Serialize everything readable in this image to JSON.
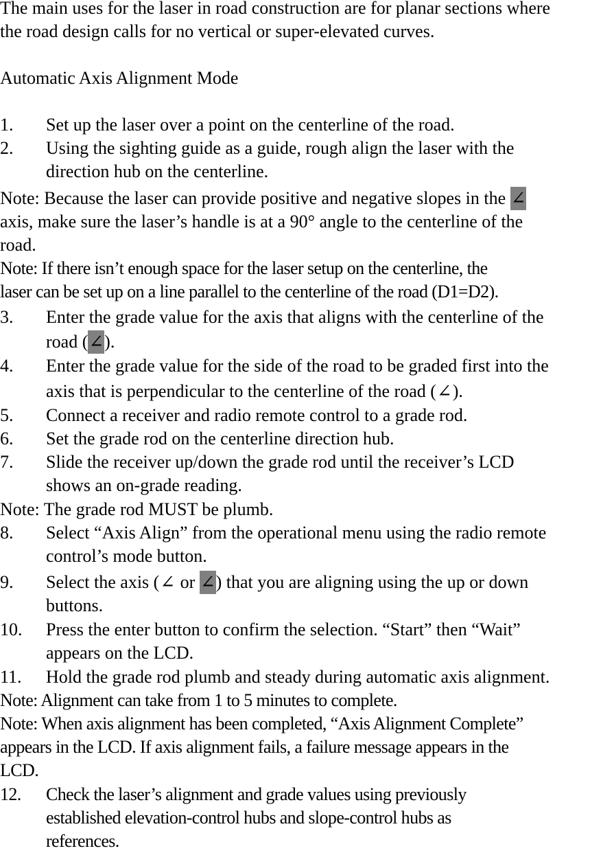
{
  "intro": {
    "line1": "The main uses for the laser in road construction are for planar sections where",
    "line2": "the road design calls for no vertical or super-elevated curves."
  },
  "heading": "Automatic Axis Alignment Mode",
  "angle_symbol": "∠",
  "highlight_color": "#808080",
  "steps": [
    {
      "num": "1.",
      "lines": [
        "Set up the laser over a point on the centerline of the road."
      ]
    },
    {
      "num": "2.",
      "lines": [
        "Using the sighting guide as a guide, rough align the laser with the",
        "direction hub on the centerline."
      ]
    },
    {
      "num": "3.",
      "lines": [
        "Enter the grade value for the axis that aligns with the centerline of the",
        "road ("
      ],
      "after": ")."
    },
    {
      "num": "4.",
      "lines": [
        "Enter the grade value for the side of the road to be graded first into the",
        "axis that is perpendicular to the centerline of the road ("
      ],
      "after": ")."
    },
    {
      "num": "5.",
      "lines": [
        "Connect a receiver and radio remote control to a grade rod."
      ]
    },
    {
      "num": "6.",
      "lines": [
        "Set the grade rod on the centerline direction hub."
      ]
    },
    {
      "num": "7.",
      "lines": [
        "Slide the receiver up/down the grade rod until the receiver’s LCD",
        "shows an on-grade reading."
      ]
    },
    {
      "num": "8.",
      "lines": [
        "Select “Axis Align” from the operational menu using the radio remote",
        "control’s mode button."
      ]
    },
    {
      "num": "9.",
      "before": "Select the axis (",
      "middle": " or ",
      "after": ") that you are aligning using the up or down",
      "line2": "buttons."
    },
    {
      "num": "10.",
      "lines": [
        "Press the enter button to confirm the selection. “Start” then “Wait”",
        "appears on the LCD."
      ]
    },
    {
      "num": "11.",
      "lines": [
        "Hold the grade rod plumb and steady during automatic axis alignment."
      ]
    },
    {
      "num": "12.",
      "lines": [
        "Check the laser’s alignment and grade values using previously",
        "established elevation-control hubs and slope-control hubs as",
        "references."
      ]
    }
  ],
  "notes": {
    "handle": {
      "line1_before": "Note: Because the laser can provide positive and negative slopes in the ",
      "line2": "axis, make sure the laser’s handle is at a 90° angle to the centerline of the",
      "line3": "road."
    },
    "space": {
      "line1": "Note: If there isn’t enough space for the laser setup on the centerline, the",
      "line2": "laser can be set up on a line parallel to the centerline of the road (D1=D2)."
    },
    "plumb": "Note: The grade rod MUST be plumb.",
    "duration": "Note: Alignment can take from 1 to 5 minutes to complete.",
    "complete": {
      "line1": "Note: When axis alignment has been completed, “Axis Alignment Complete”",
      "line2": "appears in the LCD. If axis alignment fails, a failure message appears in the",
      "line3": "LCD."
    }
  }
}
